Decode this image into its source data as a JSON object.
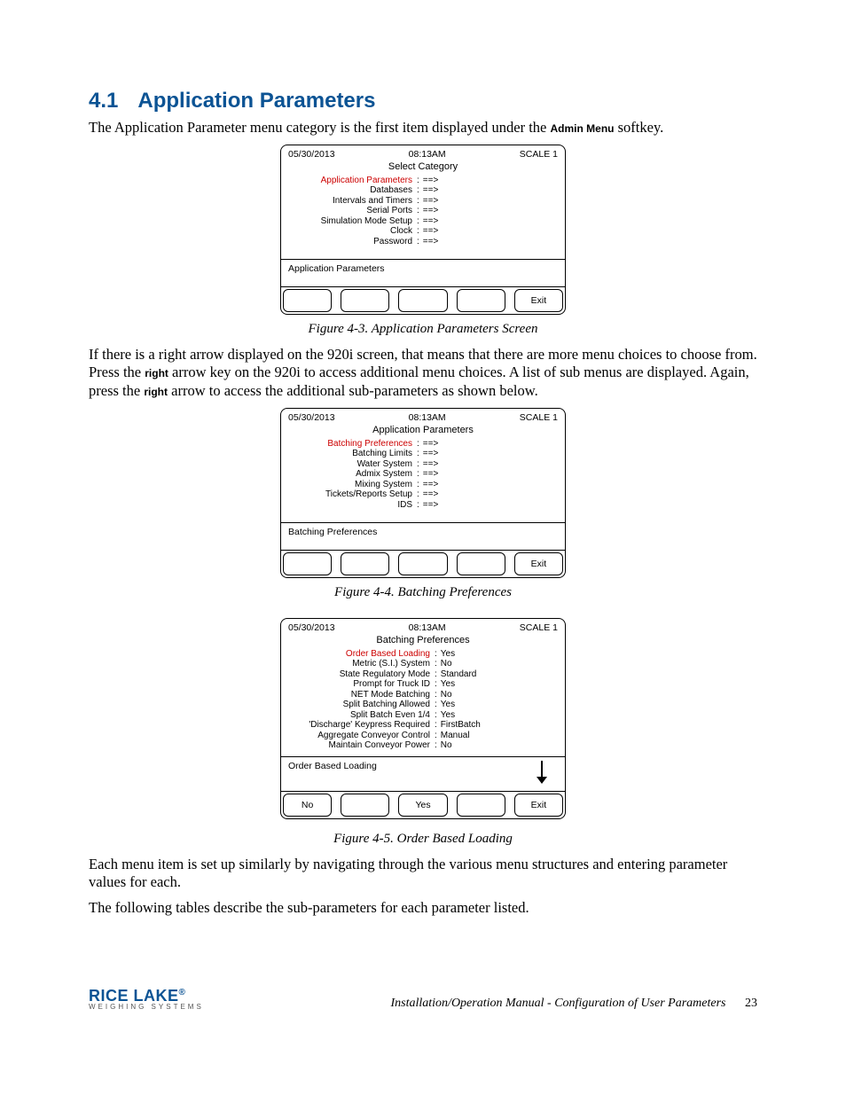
{
  "heading": {
    "number": "4.1",
    "title": "Application Parameters"
  },
  "intro_a": "The Application Parameter menu category is the first item displayed under the ",
  "intro_b": " softkey.",
  "admin_menu_label": "Admin Menu",
  "screen1": {
    "date": "05/30/2013",
    "time": "08:13AM",
    "scale": "SCALE 1",
    "title": "Select Category",
    "status": "Application Parameters",
    "items": [
      {
        "label": "Application Parameters",
        "value": "==>",
        "highlight": true
      },
      {
        "label": "Databases",
        "value": "==>",
        "highlight": false
      },
      {
        "label": "Intervals and Timers",
        "value": "==>",
        "highlight": false
      },
      {
        "label": "Serial Ports",
        "value": "==>",
        "highlight": false
      },
      {
        "label": "Simulation Mode Setup",
        "value": "==>",
        "highlight": false
      },
      {
        "label": "Clock",
        "value": "==>",
        "highlight": false
      },
      {
        "label": "Password",
        "value": "==>",
        "highlight": false
      }
    ],
    "softkeys": [
      "",
      "",
      "",
      "",
      "Exit"
    ]
  },
  "fig1_caption": "Figure 4-3. Application Parameters Screen",
  "para2_a": "If there is a right arrow displayed on the 920i screen, that means that there are more menu choices to choose from. Press the ",
  "para2_b": " arrow key on the 920i to access additional menu choices. A list of sub menus are displayed. Again, press the ",
  "para2_c": " arrow to access the additional sub-parameters as shown below.",
  "right_label": "right",
  "screen2": {
    "date": "05/30/2013",
    "time": "08:13AM",
    "scale": "SCALE 1",
    "title": "Application Parameters",
    "status": "Batching Preferences",
    "items": [
      {
        "label": "Batching Preferences",
        "value": "==>",
        "highlight": true
      },
      {
        "label": "Batching Limits",
        "value": "==>",
        "highlight": false
      },
      {
        "label": "Water System",
        "value": "==>",
        "highlight": false
      },
      {
        "label": "Admix System",
        "value": "==>",
        "highlight": false
      },
      {
        "label": "Mixing System",
        "value": "==>",
        "highlight": false
      },
      {
        "label": "Tickets/Reports Setup",
        "value": "==>",
        "highlight": false
      },
      {
        "label": "IDS",
        "value": "==>",
        "highlight": false
      }
    ],
    "softkeys": [
      "",
      "",
      "",
      "",
      "Exit"
    ]
  },
  "fig2_caption": "Figure 4-4. Batching Preferences",
  "screen3": {
    "date": "05/30/2013",
    "time": "08:13AM",
    "scale": "SCALE 1",
    "title": "Batching Preferences",
    "status": "Order Based Loading",
    "items": [
      {
        "label": "Order Based Loading",
        "value": "Yes",
        "highlight": true
      },
      {
        "label": "Metric (S.I.) System",
        "value": "No",
        "highlight": false
      },
      {
        "label": "State Regulatory Mode",
        "value": "Standard",
        "highlight": false
      },
      {
        "label": "Prompt for Truck ID",
        "value": "Yes",
        "highlight": false
      },
      {
        "label": "NET Mode Batching",
        "value": "No",
        "highlight": false
      },
      {
        "label": "Split Batching Allowed",
        "value": "Yes",
        "highlight": false
      },
      {
        "label": "Split Batch Even 1/4",
        "value": "Yes",
        "highlight": false
      },
      {
        "label": "'Discharge' Keypress Required",
        "value": "FirstBatch",
        "highlight": false
      },
      {
        "label": "Aggregate Conveyor Control",
        "value": "Manual",
        "highlight": false
      },
      {
        "label": "Maintain Conveyor Power",
        "value": "No",
        "highlight": false
      }
    ],
    "softkeys": [
      "No",
      "",
      "Yes",
      "",
      "Exit"
    ],
    "show_arrow": true
  },
  "fig3_caption": "Figure 4-5. Order Based Loading",
  "para3": "Each menu item is set up similarly by navigating through the various menu structures and entering parameter values for each.",
  "para4": "The following tables describe the sub-parameters for each parameter listed.",
  "footer": {
    "brand": "RICE LAKE",
    "tag": "WEIGHING SYSTEMS",
    "doc_title": "Installation/Operation Manual - Configuration of User Parameters",
    "page": "23"
  }
}
